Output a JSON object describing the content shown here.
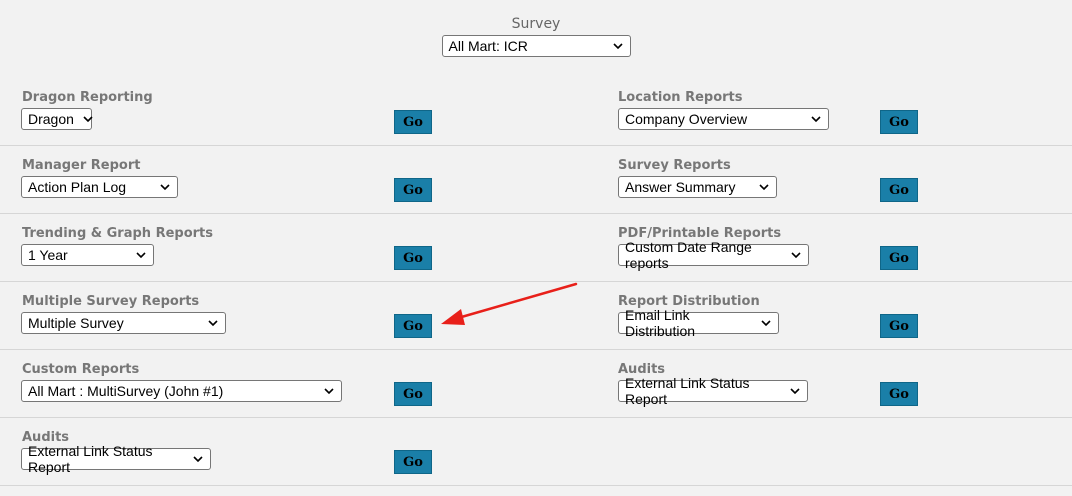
{
  "survey": {
    "label": "Survey",
    "selected": "All Mart: ICR"
  },
  "go_label": "Go",
  "left": [
    {
      "title": "Dragon Reporting",
      "selected": "Dragon"
    },
    {
      "title": "Manager Report",
      "selected": "Action Plan Log"
    },
    {
      "title": "Trending & Graph Reports",
      "selected": "1 Year"
    },
    {
      "title": "Multiple Survey Reports",
      "selected": "Multiple Survey"
    },
    {
      "title": "Custom Reports",
      "selected": "All Mart : MultiSurvey (John #1)"
    },
    {
      "title": "Audits",
      "selected": "External Link Status Report"
    }
  ],
  "right": [
    {
      "title": "Location Reports",
      "selected": "Company Overview"
    },
    {
      "title": "Survey Reports",
      "selected": "Answer Summary"
    },
    {
      "title": "PDF/Printable Reports",
      "selected": "Custom Date Range reports"
    },
    {
      "title": "Report Distribution",
      "selected": "Email Link Distribution"
    },
    {
      "title": "Audits",
      "selected": "External Link Status Report"
    }
  ],
  "colors": {
    "go_button": "#1a7fa8",
    "title_text": "#777777",
    "background": "#f2f2f2",
    "annotation_arrow": "#e8201a"
  }
}
